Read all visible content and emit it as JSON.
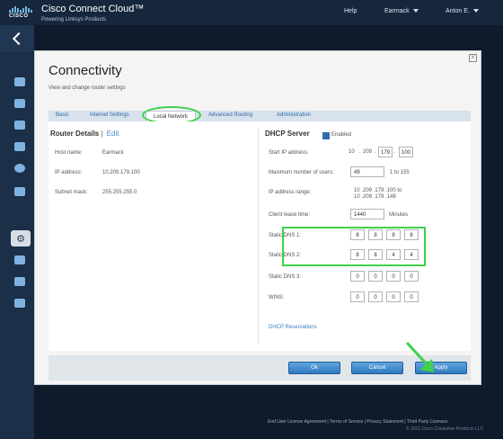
{
  "header": {
    "brand_title": "Cisco Connect Cloud™",
    "brand_subtitle": "Powering Linksys Products",
    "logo_text": "CISCO",
    "help": "Help",
    "router_menu": "Earmack",
    "user_menu": "Anton E."
  },
  "dialog": {
    "title": "Connectivity",
    "subtitle": "View and change router settings",
    "close_label": "x",
    "tabs": [
      {
        "label": "Basic"
      },
      {
        "label": "Internet Settings"
      },
      {
        "label": "Local Network"
      },
      {
        "label": "Advanced Routing"
      },
      {
        "label": "Administration"
      }
    ]
  },
  "router_details": {
    "title": "Router Details",
    "edit": "Edit",
    "rows": [
      {
        "label": "Host name:",
        "value": "Earmack"
      },
      {
        "label": "IP address:",
        "value": "10.209.179.100"
      },
      {
        "label": "Subnet mask:",
        "value": "255.255.255.0"
      }
    ]
  },
  "dhcp": {
    "title": "DHCP Server",
    "enabled_label": "Enabled",
    "enabled": true,
    "start_ip_label": "Start IP address:",
    "start_ip": [
      "10",
      "209",
      "179",
      "100"
    ],
    "max_users_label": "Maximum number of users:",
    "max_users": "49",
    "max_users_range": "1 to 155",
    "ip_range_label": "IP address range:",
    "ip_range_line1": "10 .209 .179 .100 to",
    "ip_range_line2": "10 .209 .179 .148",
    "lease_label": "Client lease time:",
    "lease_value": "1440",
    "lease_unit": "Minutes",
    "dns1_label": "Static DNS 1:",
    "dns1": [
      "8",
      "8",
      "8",
      "8"
    ],
    "dns2_label": "Static DNS 2:",
    "dns2": [
      "8",
      "8",
      "4",
      "4"
    ],
    "dns3_label": "Static DNS 3:",
    "dns3": [
      "0",
      "0",
      "0",
      "0"
    ],
    "wins_label": "WINS:",
    "wins": [
      "0",
      "0",
      "0",
      "0"
    ],
    "reservations": "DHCP Reservations"
  },
  "buttons": {
    "ok": "Ok",
    "cancel": "Cancel",
    "apply": "Apply"
  },
  "footer": {
    "links": "End User License Agreement | Terms of Service | Privacy Statement | Third Party Licenses",
    "copyright": "© 2012 Cisco Consumer Products LLC"
  },
  "colors": {
    "highlight": "#3fd14a",
    "accent": "#2f79c0",
    "topbar": "#15263d"
  }
}
